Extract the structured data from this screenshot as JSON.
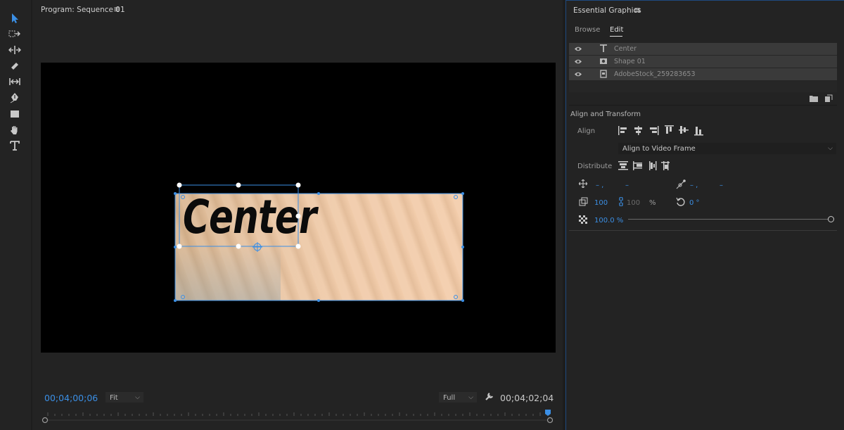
{
  "toolbar": {
    "tools": [
      "selection-tool",
      "track-select-tool",
      "ripple-edit-tool",
      "razor-tool",
      "slip-tool",
      "pen-tool",
      "rectangle-tool",
      "hand-tool",
      "type-tool"
    ]
  },
  "program": {
    "title": "Program: Sequence 01",
    "menu": "≡",
    "timecode_current": "00;04;00;06",
    "fit_label": "Fit",
    "quality_label": "Full",
    "timecode_duration": "00;04;02;04",
    "overlay_text": "Center"
  },
  "essential_graphics": {
    "title": "Essential Graphics",
    "menu": "≡",
    "tabs": [
      "Browse",
      "Edit"
    ],
    "active_tab": "Edit",
    "layers": [
      {
        "name": "Center",
        "icon": "text-layer-icon"
      },
      {
        "name": "Shape 01",
        "icon": "shape-layer-icon"
      },
      {
        "name": "AdobeStock_259283653",
        "icon": "clip-layer-icon"
      }
    ],
    "section_title": "Align and Transform",
    "align_label": "Align",
    "align_to": "Align to Video Frame",
    "distribute_label": "Distribute",
    "position": {
      "x": "– ,",
      "y": "–"
    },
    "anchor": {
      "x": "– ,",
      "y": "–"
    },
    "scale": "100",
    "scale_linked": "100",
    "scale_unit": "%",
    "rotation": "0 °",
    "opacity": "100.0 %",
    "opacity_level": 1.0
  },
  "colors": {
    "accent": "#3b8fe5",
    "panel": "#232323",
    "layer_row": "#3a3a3a"
  }
}
